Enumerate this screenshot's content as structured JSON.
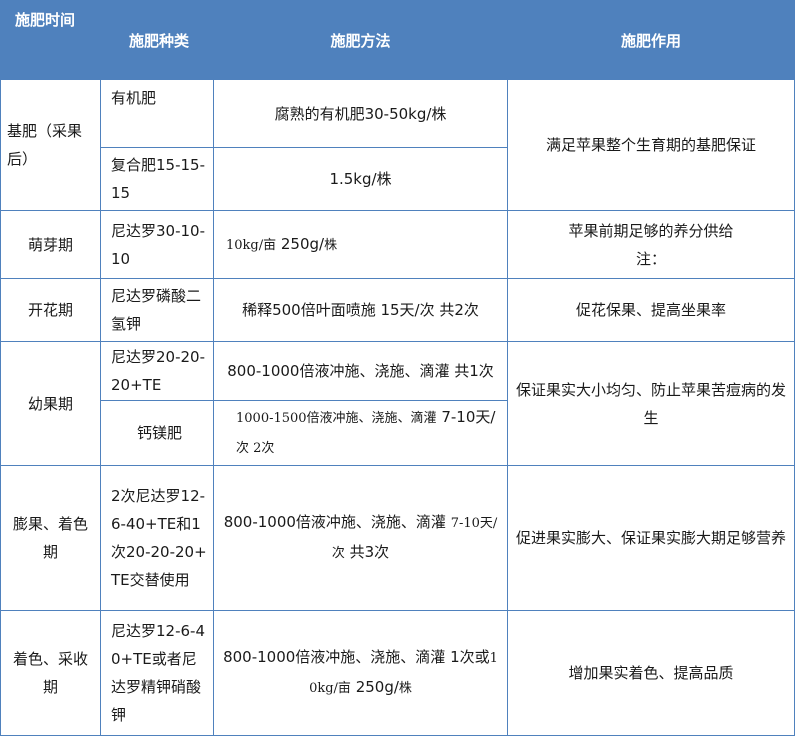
{
  "header": {
    "col1": "施肥时间",
    "col2": "施肥种类",
    "col3": "施肥方法",
    "col4": "施肥作用"
  },
  "rows": {
    "r1": {
      "time": "基肥（采果后）",
      "kind1": "有机肥",
      "method1": "腐熟的有机肥30-50kg/株",
      "kind2": "复合肥15-15-15",
      "method2": "1.5kg/株",
      "effect": "满足苹果整个生育期的基肥保证"
    },
    "r2": {
      "time": "萌芽期",
      "kind": "尼达罗30-10-10",
      "method_a": "10kg/亩",
      "method_b": " 250g/",
      "method_c": "株",
      "effect": "苹果前期足够的养分供给",
      "note": "注："
    },
    "r3": {
      "time": "开花期",
      "kind": "尼达罗磷酸二氢钾",
      "method": "稀释500倍叶面喷施  15天/次  共2次",
      "effect": "促花保果、提高坐果率"
    },
    "r4": {
      "time": "幼果期",
      "kind1": "尼达罗20-20-20+TE",
      "method1": "800-1000倍液冲施、浇施、滴灌 共1次",
      "kind2": "钙镁肥",
      "method2_a": "1000-1500倍液冲施、浇施、滴灌",
      "method2_b": " 7-10天/",
      "method2_c": "次 2次",
      "effect": "保证果实大小均匀、防止苹果苦痘病的发生"
    },
    "r5": {
      "time": "膨果、着色期",
      "kind": "2次尼达罗12-6-40+TE和1次20-20-20+TE交替使用",
      "method_a": "800-1000倍液冲施、浇施、滴灌 ",
      "method_b": "7-10天/次",
      "method_c": " 共3次",
      "effect": "促进果实膨大、保证果实膨大期足够营养"
    },
    "r6": {
      "time": "着色、采收期",
      "kind": "尼达罗12-6-40+TE或者尼达罗精钾硝酸钾",
      "method_a": "800-1000倍液冲施、浇施、滴灌 1次或",
      "method_b": "10kg/亩",
      "method_c": " 250g/",
      "method_d": "株",
      "effect": "增加果实着色、提高品质"
    }
  }
}
